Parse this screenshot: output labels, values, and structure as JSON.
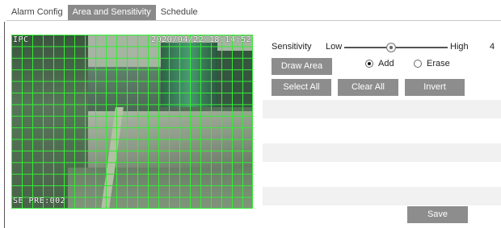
{
  "tabs": [
    {
      "label": "Alarm Config"
    },
    {
      "label": "Area and Sensitivity"
    },
    {
      "label": "Schedule"
    }
  ],
  "video": {
    "osd_top_left": "IPC",
    "osd_timestamp": "2020/04/22 18:14:52",
    "osd_bottom_left": "SE PRE:002"
  },
  "sensitivity": {
    "label": "Sensitivity",
    "low_label": "Low",
    "high_label": "High",
    "value": "4",
    "slider_fraction": 0.45
  },
  "draw_area_button": "Draw Area",
  "mode": {
    "add_label": "Add",
    "erase_label": "Erase",
    "selected": "Add"
  },
  "buttons": {
    "select_all": "Select All",
    "clear_all": "Clear All",
    "invert": "Invert",
    "save": "Save"
  },
  "colors": {
    "grid": "#33ee33",
    "button_bg": "#8d8d8d",
    "active_tab_bg": "#8a8a8a"
  }
}
